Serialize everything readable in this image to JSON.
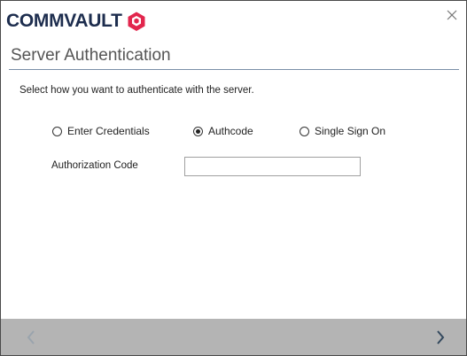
{
  "brand": {
    "name": "COMMVAULT",
    "accent": "#e2264d",
    "text_color": "#1d2d4e"
  },
  "window": {
    "close_icon": "close-icon"
  },
  "dialog": {
    "title": "Server Authentication",
    "instruction": "Select how you want to authenticate with the server."
  },
  "auth_options": [
    {
      "label": "Enter Credentials",
      "selected": false
    },
    {
      "label": "Authcode",
      "selected": true
    },
    {
      "label": "Single Sign On",
      "selected": false
    }
  ],
  "authorization_code": {
    "label": "Authorization Code",
    "value": ""
  },
  "footer": {
    "back_icon": "chevron-left-icon",
    "next_icon": "chevron-right-icon",
    "back_enabled": false,
    "next_enabled": true
  }
}
